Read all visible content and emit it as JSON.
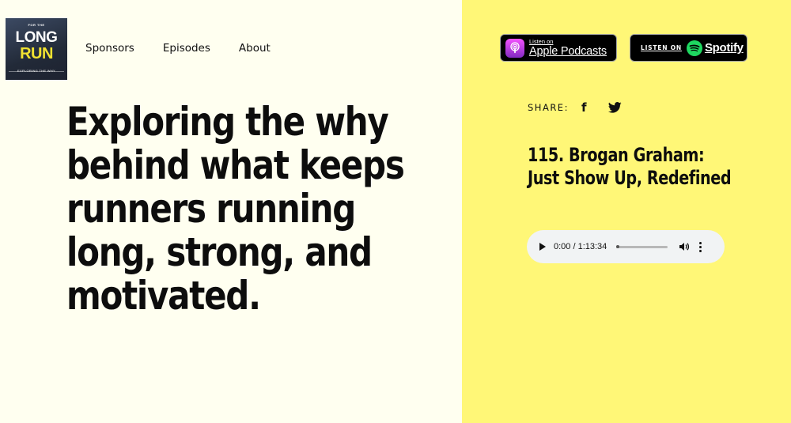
{
  "logo": {
    "top_text": "FOR THE",
    "line1": "LONG",
    "line2": "RUN",
    "tagline": "EXPLORING THE WHY"
  },
  "nav": {
    "items": [
      {
        "label": "Sponsors"
      },
      {
        "label": "Episodes"
      },
      {
        "label": "About"
      }
    ]
  },
  "hero": {
    "headline": "Exploring the why behind what keeps runners running long, strong, and motivated."
  },
  "badges": {
    "apple": {
      "small": "Listen on",
      "big": "Apple Podcasts",
      "icon": "apple-podcasts-icon"
    },
    "spotify": {
      "listen": "LISTEN ON",
      "name": "Spotify",
      "icon": "spotify-icon"
    }
  },
  "share": {
    "label": "SHARE:",
    "facebook_glyph": "f"
  },
  "episode": {
    "title": "115. Brogan Graham: Just Show Up, Redefined"
  },
  "player": {
    "time": "0:00 / 1:13:34",
    "progress": 0
  },
  "colors": {
    "left_bg": "#fffff0",
    "right_bg": "#fff777",
    "text": "#0d0d0d"
  }
}
